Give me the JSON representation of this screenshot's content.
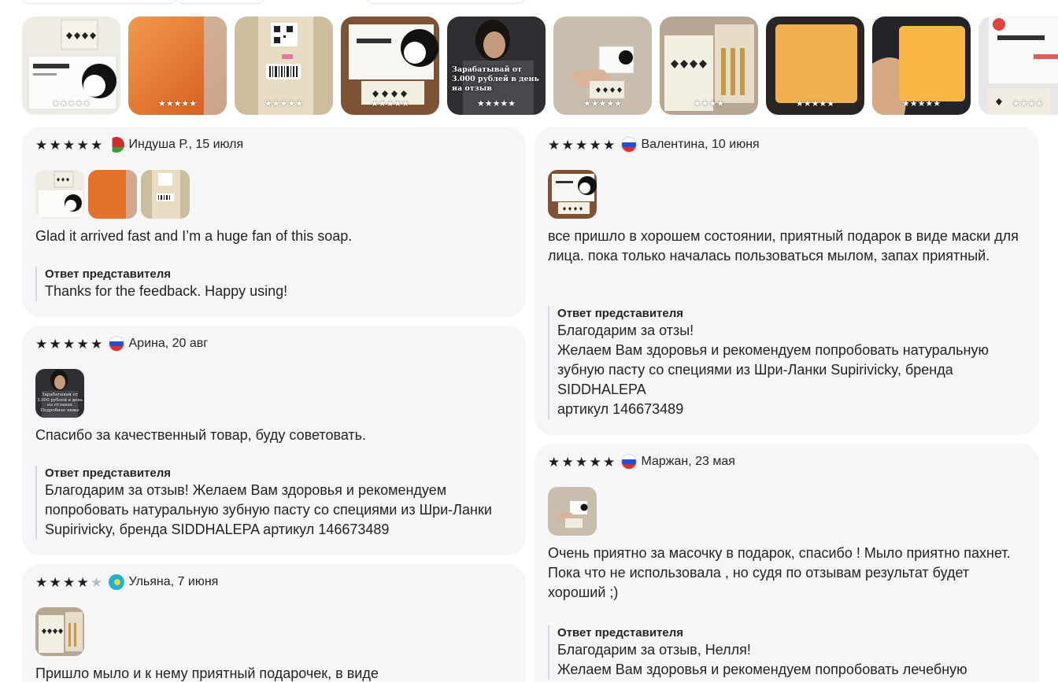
{
  "gallery": {
    "thumbs": [
      {
        "stars": "★★★★★",
        "bg": "#f3f0ea"
      },
      {
        "stars": "★★★★★",
        "bg": "#ea7b2a"
      },
      {
        "stars": "★★★★★",
        "bg": "#c9b99c"
      },
      {
        "stars": "★★★★★",
        "bg": "#8a5a38"
      },
      {
        "stars": "★★★★★",
        "bg": "#3a3a3e",
        "overlay": "Зарабатывай от 3.000 рублей в день на отзыв"
      },
      {
        "stars": "★★★★★",
        "bg": "#cbbfb2"
      },
      {
        "stars": "★★★★",
        "bg": "#b8aa98"
      },
      {
        "stars": "★★★★★",
        "bg": "#2e2a28"
      },
      {
        "stars": "★★★★★",
        "bg": "#2b2b30"
      },
      {
        "stars": "★★★★",
        "bg": "#e9e9ec"
      }
    ]
  },
  "reviews_left": [
    {
      "author": "Индуша Р., 15 июля",
      "flag": "by",
      "rating": 5,
      "text": "Glad it arrived fast and I’m a huge fan of this soap.",
      "reply_header": "Ответ представителя",
      "reply_text": "Thanks for the feedback. Happy using!"
    },
    {
      "author": "Арина, 20 авг",
      "flag": "ru",
      "rating": 5,
      "text": "Спасибо за качественный товар, буду советовать.",
      "photo_overlay": "Зарабатывай от 3.000 рублей в день на отзывах Подробнее ниже",
      "reply_header": "Ответ представителя",
      "reply_text": "Благодарим за отзыв! Желаем Вам здоровья и рекомендуем попробовать натуральную зубную пасту со специями из Шри-Ланки Supirivicky, бренда SIDDHALEPA артикул 146673489"
    },
    {
      "author": "Ульяна, 7 июня",
      "flag": "kz",
      "rating": 4,
      "text": "Пришло мыло и к нему приятный подарочек, в виде"
    }
  ],
  "reviews_right": [
    {
      "author": "Валентина, 10 июня",
      "flag": "ru",
      "rating": 5,
      "text": "все пришло в хорошем состоянии, приятный подарок в виде маски для лица. пока только началась пользоваться мылом, запах приятный.",
      "reply_header": "Ответ представителя",
      "reply_text": "Благодарим за отзы!\nЖелаем Вам здоровья и рекомендуем попробовать натуральную зубную пасту со специями из Шри-Ланки Supirivicky, бренда SIDDHALEPA\nартикул 146673489"
    },
    {
      "author": "Маржан, 23 мая",
      "flag": "ru",
      "rating": 5,
      "text": "Очень приятно за масочку в подарок, спасибо ! Мыло приятно пахнет. Пока что не использовала , но судя по отзывам результат будет хороший ;)",
      "reply_header": "Ответ представителя",
      "reply_text": "Благодарим за отзыв, Нелля!\nЖелаем Вам здоровья и рекомендуем попробовать лечебную"
    }
  ],
  "colors": {
    "card_bg": "#f6f6f9",
    "star_on": "#1d1d1f",
    "star_off": "#b9b9c3",
    "reply_bar": "#d9d9e0"
  }
}
